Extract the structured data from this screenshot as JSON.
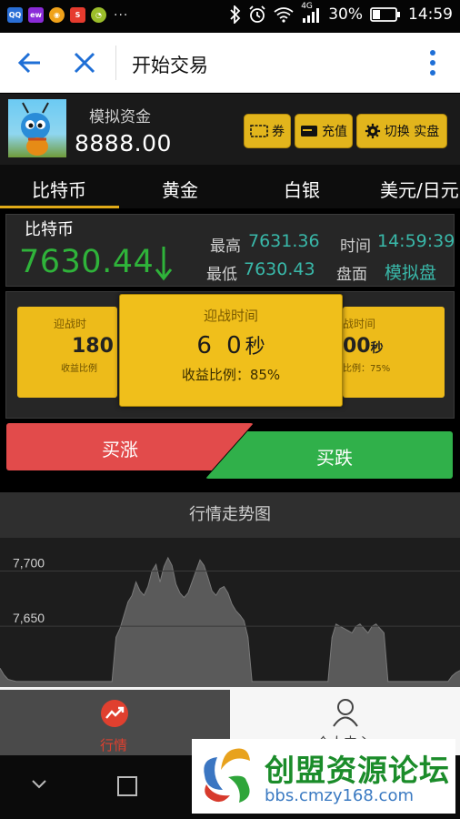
{
  "status_bar": {
    "app_icons": [
      "QQ-icon",
      "ewk-icon",
      "weibo-icon",
      "sohu-icon",
      "wechat-icon"
    ],
    "more_dots": "···",
    "network_label": "4G",
    "battery": "30%",
    "time": "14:59"
  },
  "browser": {
    "title": "开始交易",
    "back_icon": "arrow-left-icon",
    "close_icon": "close-icon",
    "menu_icon": "more-vert-icon"
  },
  "account": {
    "label": "模拟资金",
    "balance": "8888.00",
    "buttons": {
      "coupon": "券",
      "recharge": "充值",
      "switch": "切换 实盘"
    }
  },
  "tabs": [
    {
      "label": "比特币",
      "active": true
    },
    {
      "label": "黄金",
      "active": false
    },
    {
      "label": "白银",
      "active": false
    },
    {
      "label": "美元/日元",
      "active": false
    }
  ],
  "quote": {
    "name": "比特币",
    "price": "7630.44",
    "trend": "down",
    "high_label": "最高",
    "high_value": "7631.36",
    "low_label": "最低",
    "low_value": "7630.43",
    "time_label": "时间",
    "time_value": "14:59:39",
    "mode_label": "盘面",
    "mode_value": "模拟盘"
  },
  "cards": {
    "left": {
      "time_label": "迎战时",
      "seconds": "180",
      "ratio_label": "收益比例"
    },
    "main": {
      "time_label": "迎战时间",
      "seconds": "6 0",
      "unit": "秒",
      "ratio_label": "收益比例：85%"
    },
    "right": {
      "time_label": "战时间",
      "seconds": "00",
      "unit": "秒",
      "ratio_label": "比例：75%"
    }
  },
  "actions": {
    "buy_up": "买涨",
    "buy_down": "买跌"
  },
  "chart": {
    "title": "行情走势图"
  },
  "chart_data": {
    "type": "area",
    "title": "行情走势图",
    "ylim": [
      7595,
      7730
    ],
    "yticks": [
      {
        "value": 7700,
        "label": "7,700"
      },
      {
        "value": 7650,
        "label": "7,650"
      }
    ],
    "values": [
      7612,
      7606,
      7602,
      7601,
      7600,
      7600,
      7600,
      7600,
      7600,
      7600,
      7600,
      7600,
      7600,
      7600,
      7600,
      7600,
      7600,
      7600,
      7600,
      7600,
      7600,
      7600,
      7600,
      7600,
      7600,
      7600,
      7600,
      7600,
      7600,
      7640,
      7648,
      7660,
      7672,
      7678,
      7690,
      7682,
      7678,
      7686,
      7700,
      7706,
      7690,
      7704,
      7712,
      7705,
      7688,
      7680,
      7676,
      7680,
      7690,
      7700,
      7710,
      7705,
      7694,
      7682,
      7678,
      7684,
      7686,
      7680,
      7670,
      7664,
      7660,
      7655,
      7640,
      7600,
      7600,
      7600,
      7600,
      7600,
      7600,
      7600,
      7600,
      7600,
      7600,
      7600,
      7600,
      7600,
      7600,
      7600,
      7600,
      7600,
      7600,
      7600,
      7600,
      7640,
      7652,
      7650,
      7648,
      7646,
      7644,
      7650,
      7652,
      7648,
      7644,
      7650,
      7652,
      7648,
      7644,
      7600,
      7600,
      7600,
      7600,
      7600,
      7600,
      7600,
      7600,
      7600,
      7600,
      7600,
      7600,
      7600,
      7600,
      7600,
      7600,
      7605,
      7608,
      7610
    ]
  },
  "bottom_nav": {
    "market_label": "行情",
    "profile_label": "个人中心"
  },
  "watermark": {
    "title": "创盟资源论坛",
    "url": "bbs.cmzy168.com"
  }
}
